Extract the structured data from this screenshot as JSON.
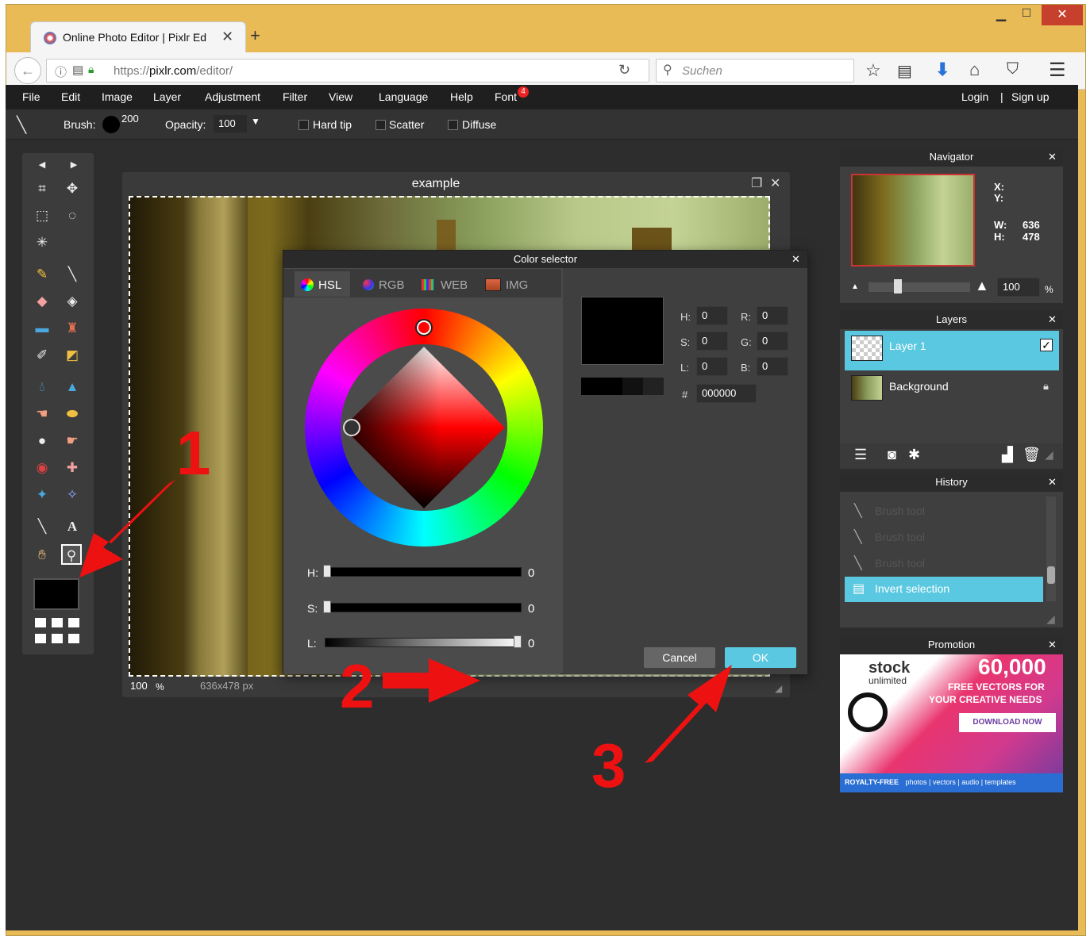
{
  "browser": {
    "tab_title": "Online Photo Editor | Pixlr Ed",
    "url_prefix": "https://",
    "url_domain": "pixlr.com",
    "url_path": "/editor/",
    "search_placeholder": "Suchen"
  },
  "menu": {
    "items": [
      "File",
      "Edit",
      "Image",
      "Layer",
      "Adjustment",
      "Filter",
      "View",
      "Language",
      "Help",
      "Font"
    ],
    "font_badge": "4",
    "login": "Login",
    "separator": "|",
    "signup": "Sign up"
  },
  "options": {
    "brush_label": "Brush:",
    "brush_size": "200",
    "opacity_label": "Opacity:",
    "opacity_value": "100",
    "hard_tip": "Hard tip",
    "scatter": "Scatter",
    "diffuse": "Diffuse"
  },
  "canvas": {
    "title": "example",
    "zoom": "100",
    "zoom_unit": "%",
    "size": "636x478 px"
  },
  "color_selector": {
    "title": "Color selector",
    "tabs": [
      "HSL",
      "RGB",
      "WEB",
      "IMG"
    ],
    "fields": {
      "h_label": "H:",
      "h": "0",
      "s_label": "S:",
      "s": "0",
      "l_label": "L:",
      "l": "0",
      "r_label": "R:",
      "r": "0",
      "g_label": "G:",
      "g": "0",
      "b_label": "B:",
      "b": "0"
    },
    "hash": "#",
    "hex": "000000",
    "slider_h_label": "H:",
    "slider_h_value": "0",
    "slider_s_label": "S:",
    "slider_s_value": "0",
    "slider_l_label": "L:",
    "slider_l_value": "0",
    "cancel": "Cancel",
    "ok": "OK"
  },
  "navigator": {
    "title": "Navigator",
    "x_label": "X:",
    "y_label": "Y:",
    "w_label": "W:",
    "w_value": "636",
    "h_label": "H:",
    "h_value": "478",
    "zoom": "100",
    "zoom_unit": "%"
  },
  "layers": {
    "title": "Layers",
    "items": [
      "Layer 1",
      "Background"
    ]
  },
  "history": {
    "title": "History",
    "items": [
      "Brush tool",
      "Brush tool",
      "Brush tool",
      "Invert selection"
    ]
  },
  "promotion": {
    "title": "Promotion",
    "brand_line1": "stock",
    "brand_line2": "unlimited",
    "headline": "60,000",
    "subline1": "FREE VECTORS FOR",
    "subline2": "YOUR CREATIVE NEEDS",
    "cta": "DOWNLOAD NOW",
    "footer_bold": "ROYALTY-FREE",
    "footer_rest": "photos | vectors | audio | templates"
  },
  "annotations": [
    "1",
    "2",
    "3"
  ],
  "colors": {
    "accent": "#5ac8e0",
    "annotation": "#ee1111",
    "app_bg": "#2d2d2d",
    "window_frame": "#e8bb56"
  }
}
